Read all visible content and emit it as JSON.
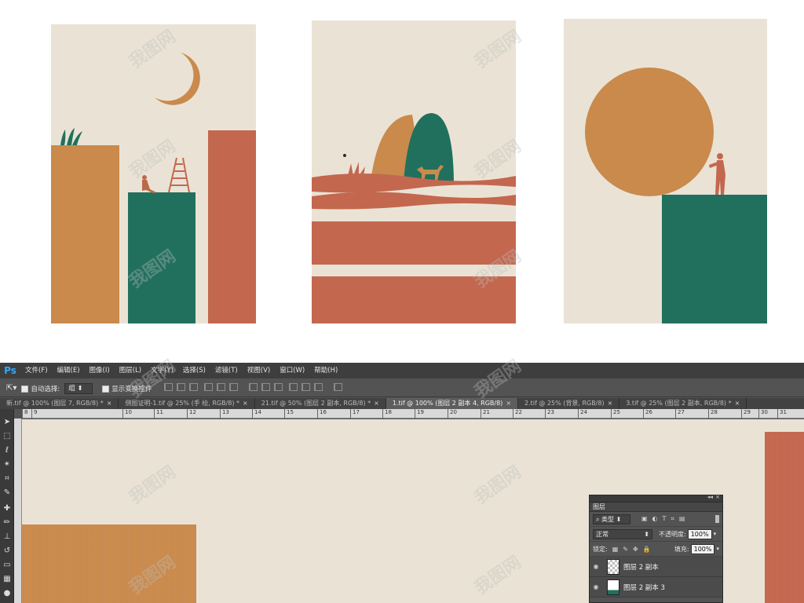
{
  "photoshop": {
    "logo": "Ps",
    "menu": [
      "文件(F)",
      "编辑(E)",
      "图像(I)",
      "图层(L)",
      "文字(Y)",
      "选择(S)",
      "滤镜(T)",
      "视图(V)",
      "窗口(W)",
      "帮助(H)"
    ],
    "options": {
      "auto_select_label": "自动选择:",
      "auto_select_value": "组",
      "show_transform_label": "显示变换控件"
    },
    "tabs": [
      {
        "label": "新.tif @ 100% (图层 7, RGB/8) *",
        "active": false
      },
      {
        "label": "侧图证明-1.tif @ 25% (手 绘, RGB/8) *",
        "active": false
      },
      {
        "label": "21.tif @ 50% (图层 2 副本, RGB/8) *",
        "active": false
      },
      {
        "label": "1.tif @ 100% (图层 2 副本 4, RGB/8)",
        "active": true
      },
      {
        "label": "2.tif @ 25% (背景, RGB/8)",
        "active": false
      },
      {
        "label": "3.tif @ 25% (图层 2 副本, RGB/8) *",
        "active": false
      }
    ],
    "ruler_h": [
      "8",
      "9",
      "10",
      "11",
      "12",
      "13",
      "14",
      "15",
      "16",
      "17",
      "18",
      "19",
      "20",
      "21",
      "22",
      "23",
      "24",
      "25",
      "26",
      "27",
      "28",
      "29",
      "30",
      "31"
    ],
    "layers_panel": {
      "title": "图层",
      "filter_label": "类型",
      "blend_mode": "正常",
      "opacity_label": "不透明度:",
      "opacity_value": "100%",
      "lock_label": "锁定:",
      "fill_label": "填充:",
      "fill_value": "100%",
      "layers": [
        "图层 2 副本",
        "图层 2 副本 3"
      ]
    }
  },
  "watermark_text": "我图网",
  "colors": {
    "background": "#eae3d5",
    "ochre": "#c98a4c",
    "rust": "#c4674f",
    "green": "#21705d",
    "ps_dark": "#535353"
  }
}
